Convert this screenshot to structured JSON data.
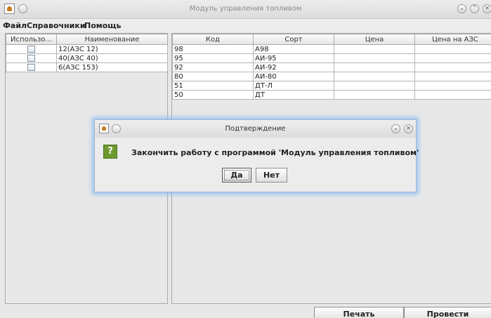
{
  "window": {
    "title": "Модуль управления топливом"
  },
  "menu": {
    "items": [
      "Файл",
      "Справочники",
      "Помощь"
    ]
  },
  "left_table": {
    "columns": [
      "Использо...",
      "Наименование"
    ],
    "rows": [
      {
        "checked": false,
        "name": "12(АЗС 12)"
      },
      {
        "checked": false,
        "name": "40(АЗС 40)"
      },
      {
        "checked": false,
        "name": "6(АЗС 153)"
      }
    ]
  },
  "right_table": {
    "columns": [
      "Код",
      "Сорт",
      "Цена",
      "Цена на АЗС"
    ],
    "rows": [
      {
        "code": "98",
        "grade": "А98",
        "price": "",
        "station_price": ""
      },
      {
        "code": "95",
        "grade": "АИ-95",
        "price": "",
        "station_price": ""
      },
      {
        "code": "92",
        "grade": "АИ-92",
        "price": "",
        "station_price": ""
      },
      {
        "code": "80",
        "grade": "АИ-80",
        "price": "",
        "station_price": ""
      },
      {
        "code": "51",
        "grade": "ДТ-Л",
        "price": "",
        "station_price": ""
      },
      {
        "code": "50",
        "grade": "ДТ",
        "price": "",
        "station_price": ""
      }
    ]
  },
  "buttons": {
    "print": "Печать",
    "submit": "Провести"
  },
  "dialog": {
    "title": "Подтверждение",
    "icon_glyph": "?",
    "message": "Закончить работу с программой 'Модуль управления топливом'",
    "yes": "Да",
    "no": "Нет"
  },
  "icons": {
    "app": "java-cup-icon",
    "question": "question-icon",
    "minimize": "minimize-icon",
    "maximize": "maximize-icon",
    "close": "close-icon"
  },
  "colors": {
    "dialog_glow": "#8cbef0",
    "question_icon_bg": "#6c9a2e"
  }
}
